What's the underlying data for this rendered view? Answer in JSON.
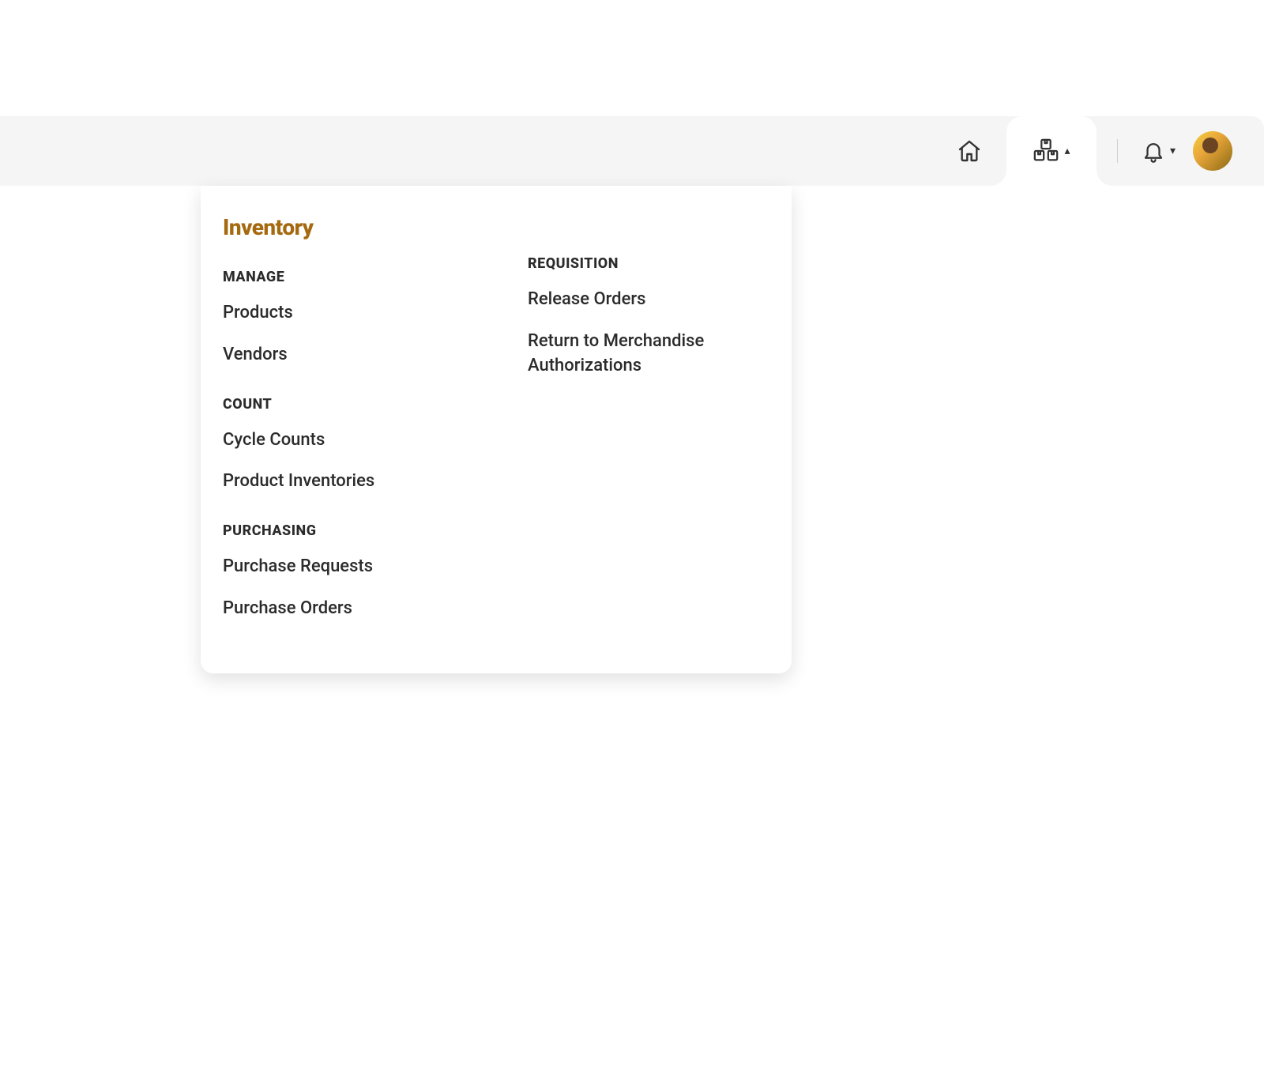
{
  "dropdown": {
    "title": "Inventory",
    "columns": [
      {
        "sections": [
          {
            "header": "MANAGE",
            "items": [
              "Products",
              "Vendors"
            ]
          },
          {
            "header": "COUNT",
            "items": [
              "Cycle Counts",
              "Product Inventories"
            ]
          },
          {
            "header": "PURCHASING",
            "items": [
              "Purchase Requests",
              "Purchase Orders"
            ]
          }
        ]
      },
      {
        "sections": [
          {
            "header": "REQUISITION",
            "items": [
              "Release Orders",
              "Return to Merchandise Authorizations"
            ]
          }
        ]
      }
    ]
  }
}
